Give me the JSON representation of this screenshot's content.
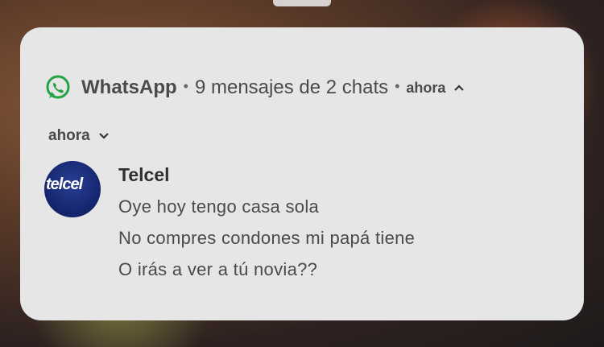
{
  "notification": {
    "app_name": "WhatsApp",
    "separator": "•",
    "summary": "9 mensajes de 2 chats",
    "time": "ahora",
    "group_time": "ahora",
    "avatar_text": "telcel",
    "sender": "Telcel",
    "messages": [
      "Oye hoy tengo casa sola",
      "No compres condones mi papá tiene",
      "O irás a ver a tú novia??"
    ]
  },
  "colors": {
    "card": "#e7e6e6",
    "accent_whatsapp": "#25a244",
    "avatar_blue": "#1a2c7c"
  },
  "icons": {
    "app": "whatsapp-icon",
    "collapse": "chevron-up-icon",
    "expand": "chevron-down-icon"
  }
}
